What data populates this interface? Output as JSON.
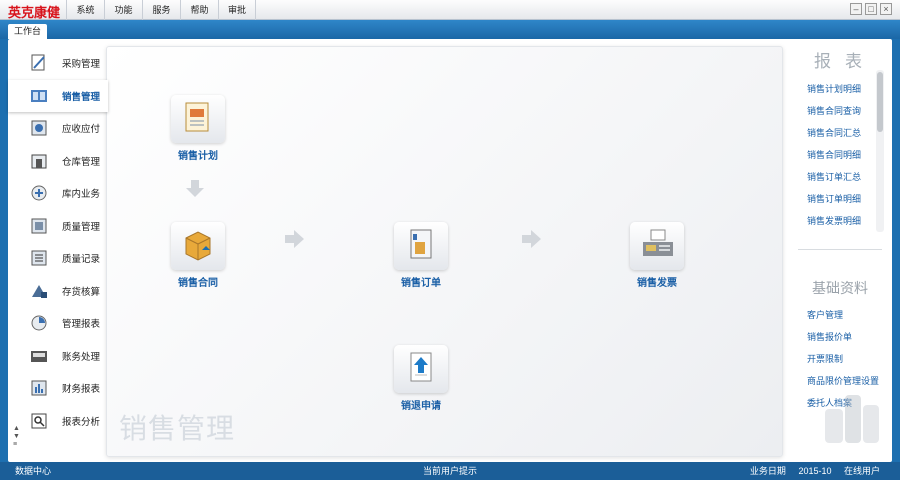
{
  "app": {
    "brand": "英克康健",
    "brand_color": "#d8141c",
    "accent": "#1d6fb0"
  },
  "menu": [
    "系统",
    "功能",
    "服务",
    "帮助",
    "审批"
  ],
  "window_controls": [
    "minimize-icon",
    "maximize-icon",
    "close-icon"
  ],
  "tab": {
    "label": "工作台"
  },
  "sidebar": {
    "items": [
      {
        "label": "采购管理",
        "icon": "purchase-icon",
        "active": false
      },
      {
        "label": "销售管理",
        "icon": "sales-icon",
        "active": true
      },
      {
        "label": "应收应付",
        "icon": "receivable-icon",
        "active": false
      },
      {
        "label": "仓库管理",
        "icon": "warehouse-icon",
        "active": false
      },
      {
        "label": "库内业务",
        "icon": "inventory-business-icon",
        "active": false
      },
      {
        "label": "质量管理",
        "icon": "quality-icon",
        "active": false
      },
      {
        "label": "质量记录",
        "icon": "quality-record-icon",
        "active": false
      },
      {
        "label": "存货核算",
        "icon": "stock-accounting-icon",
        "active": false
      },
      {
        "label": "管理报表",
        "icon": "management-report-icon",
        "active": false
      },
      {
        "label": "账务处理",
        "icon": "ledger-icon",
        "active": false
      },
      {
        "label": "财务报表",
        "icon": "finance-report-icon",
        "active": false
      },
      {
        "label": "报表分析",
        "icon": "report-analysis-icon",
        "active": false
      }
    ]
  },
  "workflow": {
    "title": "销售管理",
    "nodes": [
      {
        "label": "销售计划",
        "icon": "sales-plan-icon"
      },
      {
        "label": "销售合同",
        "icon": "sales-contract-icon"
      },
      {
        "label": "销售订单",
        "icon": "sales-order-icon"
      },
      {
        "label": "销售发票",
        "icon": "sales-invoice-icon"
      },
      {
        "label": "销退申请",
        "icon": "sales-return-icon"
      }
    ]
  },
  "reports": {
    "title": "报表",
    "items": [
      "销售计划明细",
      "销售合同查询",
      "销售合同汇总",
      "销售合同明细",
      "销售订单汇总",
      "销售订单明细",
      "销售发票明细"
    ]
  },
  "basic_data": {
    "title": "基础资料",
    "items": [
      "客户管理",
      "销售报价单",
      "开票限制",
      "商品限价管理设置",
      "委托人档案"
    ]
  },
  "status": {
    "left": "数据中心",
    "center": "当前用户提示",
    "right_label": "业务日期",
    "right_date": "2015-10",
    "right_extra": "在线用户"
  }
}
